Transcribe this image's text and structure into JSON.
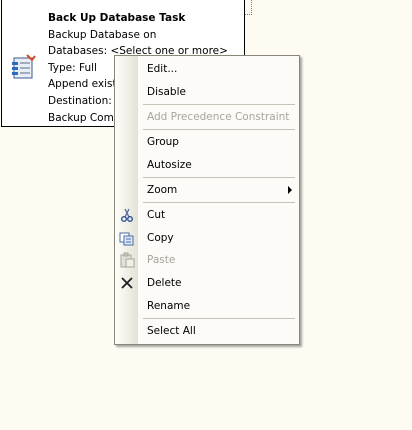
{
  "task": {
    "title": "Back Up Database Task",
    "lines": [
      "Backup Database on",
      "Databases: <Select one or more>",
      "Type: Full",
      "Append existi",
      "Destination: D",
      "Backup Compr"
    ],
    "icon": "backup-task-icon"
  },
  "context_menu": {
    "items": [
      {
        "label": "Edit...",
        "enabled": true
      },
      {
        "label": "Disable",
        "enabled": true
      },
      {
        "label": "Add Precedence Constraint",
        "enabled": false
      },
      {
        "label": "Group",
        "enabled": true
      },
      {
        "label": "Autosize",
        "enabled": true
      },
      {
        "label": "Zoom",
        "enabled": true,
        "submenu": true
      },
      {
        "label": "Cut",
        "enabled": true,
        "icon": "scissors-icon"
      },
      {
        "label": "Copy",
        "enabled": true,
        "icon": "copy-icon"
      },
      {
        "label": "Paste",
        "enabled": false,
        "icon": "paste-icon"
      },
      {
        "label": "Delete",
        "enabled": true,
        "icon": "delete-x-icon"
      },
      {
        "label": "Rename",
        "enabled": true
      },
      {
        "label": "Select All",
        "enabled": true
      }
    ]
  },
  "colors": {
    "canvas_bg": "#fdfbf2",
    "menu_bg": "#fcfbf8",
    "disabled_text": "#a7a59d"
  }
}
